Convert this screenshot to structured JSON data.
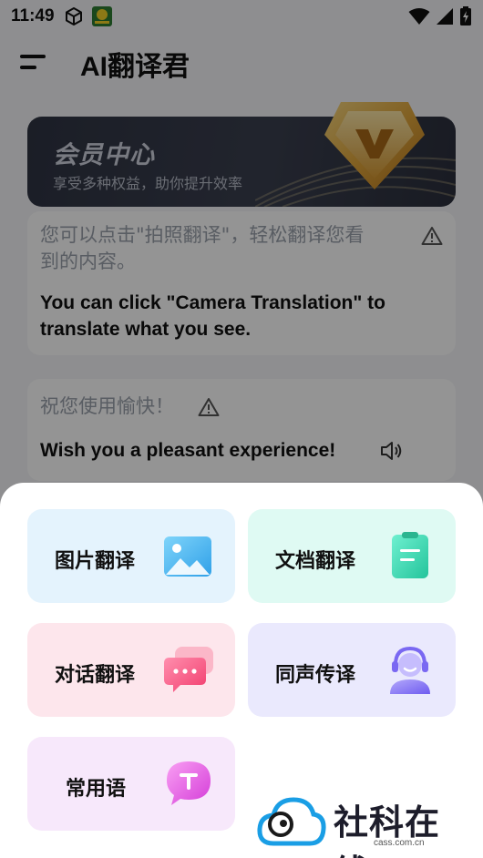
{
  "status_bar": {
    "time": "11:49"
  },
  "header": {
    "title": "AI翻译君"
  },
  "member": {
    "title": "会员中心",
    "subtitle": "享受多种权益，助你提升效率"
  },
  "messages": [
    {
      "source": "您可以点击\"拍照翻译\"，轻松翻译您看",
      "source_line2": "到的内容。",
      "translation": "You can click \"Camera Translation\" to",
      "translation_line2": "translate what you see."
    },
    {
      "source": "祝您使用愉快！",
      "translation": "Wish you a pleasant experience!"
    }
  ],
  "menu": {
    "items": [
      {
        "label": "图片翻译",
        "icon": "image-icon",
        "color": "#4fb6ef"
      },
      {
        "label": "文档翻译",
        "icon": "document-icon",
        "color": "#3fd9b4"
      },
      {
        "label": "对话翻译",
        "icon": "chat-bubbles-icon",
        "color": "#f45e86"
      },
      {
        "label": "同声传译",
        "icon": "headset-agent-icon",
        "color": "#8a7cf4"
      },
      {
        "label": "常用语",
        "icon": "phrase-bubble-icon",
        "color": "#e25fe3"
      }
    ]
  },
  "watermark": {
    "text": "社科在线",
    "url": "cass.com.cn"
  }
}
